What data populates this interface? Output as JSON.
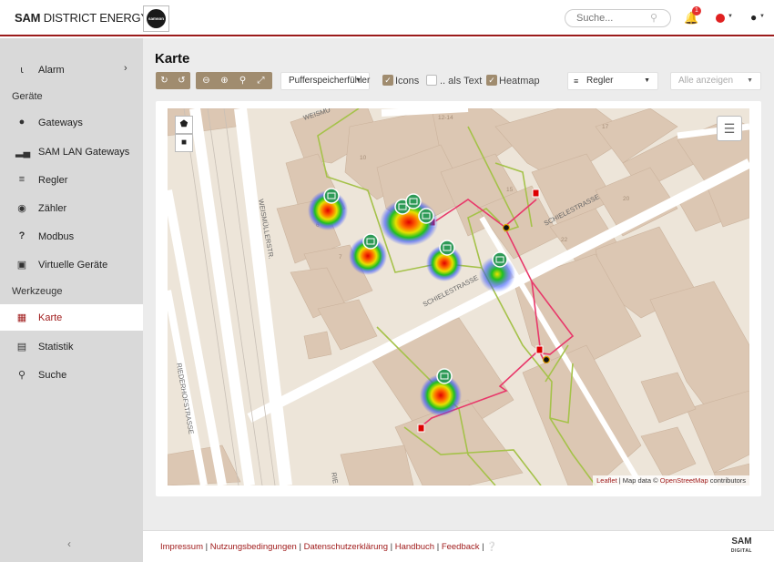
{
  "header": {
    "brand_bold": "SAM",
    "brand_rest": " DISTRICT ENERGY",
    "logo_text": "samson",
    "search_placeholder": "Suche...",
    "notification_count": "1"
  },
  "sidebar": {
    "items_top": [
      {
        "label": "Alarm",
        "icon": "bell-icon"
      }
    ],
    "section_devices": "Geräte",
    "devices": [
      {
        "label": "Gateways",
        "icon": "globe-icon"
      },
      {
        "label": "SAM LAN Gateways",
        "icon": "signal-icon"
      },
      {
        "label": "Regler",
        "icon": "sliders-icon"
      },
      {
        "label": "Zähler",
        "icon": "gauge-icon"
      },
      {
        "label": "Modbus",
        "icon": "question-icon"
      },
      {
        "label": "Virtuelle Geräte",
        "icon": "sitemap-icon"
      }
    ],
    "section_tools": "Werkzeuge",
    "tools": [
      {
        "label": "Karte",
        "icon": "map-icon",
        "active": true
      },
      {
        "label": "Statistik",
        "icon": "bar-chart-icon"
      },
      {
        "label": "Suche",
        "icon": "search-icon"
      }
    ]
  },
  "main": {
    "title": "Karte",
    "sensor_select": "Pufferspeicherfühler",
    "checkboxes": {
      "icons_label": "Icons",
      "icons_checked": true,
      "as_text_label": ".. als Text",
      "as_text_checked": false,
      "heatmap_label": "Heatmap",
      "heatmap_checked": true
    },
    "device_type_select": "Regler",
    "filter_select": "Alle anzeigen"
  },
  "map": {
    "streets": [
      "WEISMÜLLERSTR.",
      "SCHIELESTRASSE",
      "SCHIELESTRASSE",
      "RIEDERHOFSTRASSE",
      "WEISMÜ",
      "RIE"
    ],
    "house_numbers": [
      "12-14",
      "10",
      "17",
      "15",
      "6",
      "20",
      "22",
      "7"
    ],
    "attribution": {
      "leaflet": "Leaflet",
      "sep": " | Map data © ",
      "osm": "OpenStreetMap",
      "rest": " contributors"
    }
  },
  "footer": {
    "links": [
      "Impressum",
      "Nutzungsbedingungen",
      "Datenschutzerklärung",
      "Handbuch",
      "Feedback"
    ],
    "logo_top": "SAM",
    "logo_bottom": "DIGITAL"
  },
  "colors": {
    "accent": "#a01c1c",
    "toolbar": "#a08c6f",
    "sidebar_bg": "#d9d9d9",
    "map_bg": "#ede5d9"
  }
}
